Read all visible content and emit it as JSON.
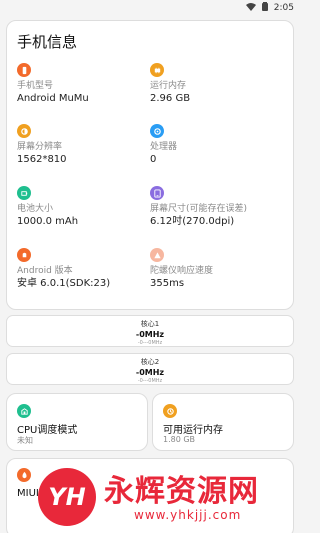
{
  "statusbar": {
    "time": "2:05"
  },
  "info": {
    "title": "手机信息",
    "items": [
      {
        "label": "手机型号",
        "value": "Android MuMu",
        "color": "#f36a2b",
        "icon": "phone-icon"
      },
      {
        "label": "运行内存",
        "value": "2.96 GB",
        "color": "#f0a020",
        "icon": "memory-icon"
      },
      {
        "label": "屏幕分辨率",
        "value": "1562*810",
        "color": "#f0a020",
        "icon": "resolution-icon"
      },
      {
        "label": "处理器",
        "value": "0",
        "color": "#2a9df4",
        "icon": "processor-icon"
      },
      {
        "label": "电池大小",
        "value": "1000.0 mAh",
        "color": "#1fbf8f",
        "icon": "battery-icon"
      },
      {
        "label": "屏幕尺寸(可能存在误差)",
        "value": "6.12吋(270.0dpi)",
        "color": "#8a6de0",
        "icon": "screen-size-icon"
      },
      {
        "label": "Android 版本",
        "value": "安卓 6.0.1(SDK:23)",
        "color": "#f36a2b",
        "icon": "android-icon"
      },
      {
        "label": "陀螺仪响应速度",
        "value": "355ms",
        "color": "#f7b7a0",
        "icon": "gyroscope-icon"
      }
    ]
  },
  "cores": [
    {
      "name": "核心1",
      "freq": "-0MHz",
      "range": "-0---0MHz"
    },
    {
      "name": "核心2",
      "freq": "-0MHz",
      "range": "-0---0MHz"
    }
  ],
  "cpu_mode": {
    "title": "CPU调度模式",
    "value": "未知",
    "color": "#1fbf8f",
    "icon": "cpu-mode-icon"
  },
  "avail_mem": {
    "title": "可用运行内存",
    "value": "1.80 GB",
    "color": "#f0a020",
    "icon": "available-memory-icon"
  },
  "miui": {
    "title": "MIUI性能",
    "color": "#f36a2b",
    "icon": "miui-icon"
  },
  "watermark": {
    "logo": "YH",
    "text": "永辉资源网",
    "url": "www.yhkjjj.com"
  }
}
